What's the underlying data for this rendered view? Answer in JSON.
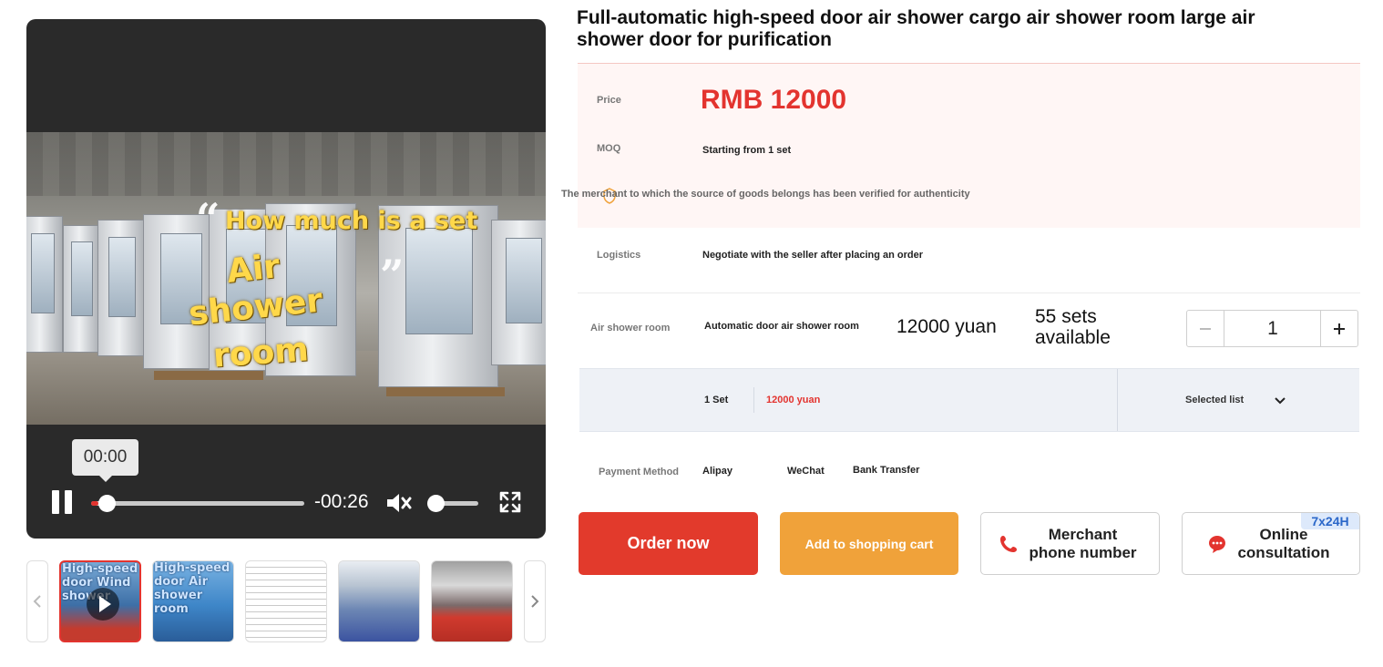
{
  "product": {
    "title": "Full-automatic high-speed door air shower cargo air shower room large air shower door for purification"
  },
  "video": {
    "overlay_line1": "How much is a set",
    "overlay_line2": "Air",
    "overlay_line3": "shower",
    "overlay_line4": "room",
    "quote_open": "“",
    "quote_close": "”",
    "tooltip_time": "00:00",
    "remaining_time": "-00:26",
    "progress": 0.0,
    "volume": 0.0,
    "state": "playing",
    "muted": true
  },
  "thumbnails": [
    {
      "caption": "High-speed door Wind shower",
      "has_video": true,
      "active": true
    },
    {
      "caption": "High-speed door Air shower room",
      "has_video": false,
      "active": false
    },
    {
      "caption": "",
      "has_video": false,
      "active": false
    },
    {
      "caption": "",
      "has_video": false,
      "active": false
    },
    {
      "caption": "",
      "has_video": false,
      "active": false
    }
  ],
  "pricing": {
    "price_label": "Price",
    "price_value": "RMB 12000",
    "moq_label": "MOQ",
    "moq_value": "Starting from 1 set",
    "verified_text": "The merchant to which the source of goods belongs has been verified for authenticity"
  },
  "logistics": {
    "label": "Logistics",
    "value": "Negotiate with the seller after placing an order"
  },
  "sku": {
    "label": "Air shower room",
    "name": "Automatic door air shower room",
    "price": "12000 yuan",
    "stock": "55 sets available",
    "quantity": "1"
  },
  "selection": {
    "quantity_text": "1 Set",
    "price_text": "12000 yuan",
    "list_label": "Selected list"
  },
  "payment": {
    "label": "Payment Method",
    "options": [
      "Alipay",
      "WeChat",
      "Bank Transfer"
    ]
  },
  "actions": {
    "order_now": "Order now",
    "add_to_cart": "Add to shopping cart",
    "phone": "Merchant phone number",
    "consult": "Online consultation",
    "consult_badge": "7x24H"
  },
  "colors": {
    "accent_red": "#e3342f",
    "cart_orange": "#f0a23a",
    "info_bg": "#fff6f5"
  },
  "icons": {
    "pause": "pause-icon",
    "mute": "volume-muted-icon",
    "fullscreen": "fullscreen-icon",
    "phone": "phone-icon",
    "chat": "chat-bubble-icon",
    "verify": "shield-check-icon",
    "chevron": "chevron-down-icon"
  }
}
